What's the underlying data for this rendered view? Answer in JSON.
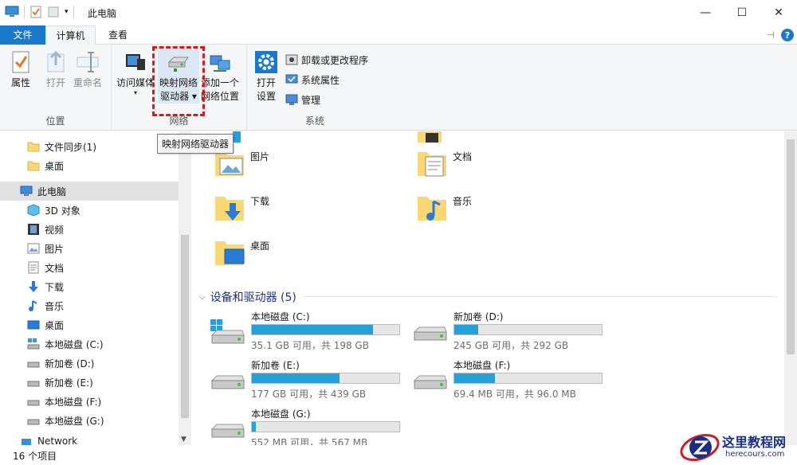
{
  "window": {
    "title": "此电脑",
    "minimize": "—",
    "maximize": "☐",
    "close": "✕"
  },
  "tabs": [
    {
      "label": "文件"
    },
    {
      "label": "计算机"
    },
    {
      "label": "查看"
    }
  ],
  "ribbon": {
    "location_group": {
      "label": "位置",
      "properties": "属性",
      "open": "打开",
      "rename": "重命名"
    },
    "network_group": {
      "label": "网络",
      "access_media": "访问媒体",
      "map_drive_line1": "映射网络",
      "map_drive_line2": "驱动器 ▾",
      "add_location_line1": "添加一个",
      "add_location_line2": "网络位置"
    },
    "system_group": {
      "label": "系统",
      "open_settings_line1": "打开",
      "open_settings_line2": "设置",
      "uninstall": "卸载或更改程序",
      "system_properties": "系统属性",
      "manage": "管理"
    }
  },
  "tooltip": "映射网络驱动器",
  "nav": {
    "items": [
      {
        "label": "文件同步(1)"
      },
      {
        "label": "桌面"
      },
      {
        "label": "此电脑"
      },
      {
        "label": "3D 对象"
      },
      {
        "label": "视频"
      },
      {
        "label": "图片"
      },
      {
        "label": "文档"
      },
      {
        "label": "下载"
      },
      {
        "label": "音乐"
      },
      {
        "label": "桌面"
      },
      {
        "label": "本地磁盘 (C:)"
      },
      {
        "label": "新加卷 (D:)"
      },
      {
        "label": "新加卷 (E:)"
      },
      {
        "label": "本地磁盘 (F:)"
      },
      {
        "label": "本地磁盘 (G:)"
      },
      {
        "label": "Network"
      }
    ]
  },
  "folders": [
    {
      "label": "图片"
    },
    {
      "label": "文档"
    },
    {
      "label": "下载"
    },
    {
      "label": "音乐"
    },
    {
      "label": "桌面"
    }
  ],
  "devices": {
    "header": "设备和驱动器 (5)",
    "drives": [
      {
        "name": "本地磁盘 (C:)",
        "info": "35.1 GB 可用，共 198 GB",
        "used_fraction": 0.823
      },
      {
        "name": "新加卷 (D:)",
        "info": "245 GB 可用，共 292 GB",
        "used_fraction": 0.161
      },
      {
        "name": "新加卷 (E:)",
        "info": "177 GB 可用，共 439 GB",
        "used_fraction": 0.597
      },
      {
        "name": "本地磁盘 (F:)",
        "info": "69.4 MB 可用，共 96.0 MB",
        "used_fraction": 0.277
      },
      {
        "name": "本地磁盘 (G:)",
        "info": "552 MB 可用，共 567 MB",
        "used_fraction": 0.026
      }
    ]
  },
  "status": {
    "count": "16 个项目"
  },
  "watermark": {
    "title": "这里教程网",
    "url": "herecours.com"
  },
  "colors": {
    "accent": "#1979ca",
    "drive_bar": "#26a0da",
    "highlight": "#e0151c"
  }
}
